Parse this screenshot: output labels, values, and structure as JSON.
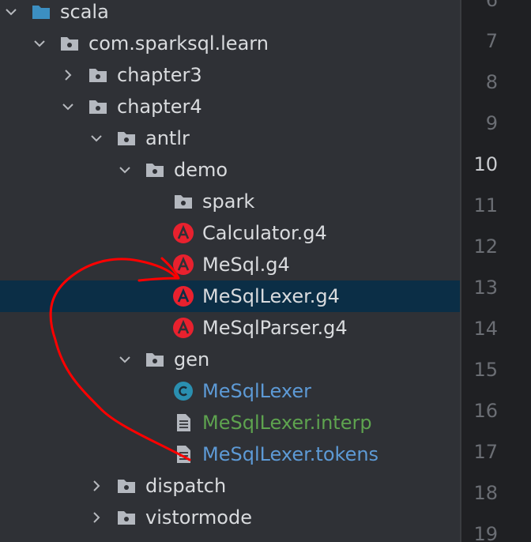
{
  "tree": {
    "items": [
      {
        "label": "scala",
        "kind": "folder",
        "color": "blue-folder",
        "expanded": true
      },
      {
        "label": "com.sparksql.learn",
        "kind": "folder",
        "expanded": true
      },
      {
        "label": "chapter3",
        "kind": "folder",
        "expanded": false
      },
      {
        "label": "chapter4",
        "kind": "folder",
        "expanded": true
      },
      {
        "label": "antlr",
        "kind": "folder",
        "expanded": true
      },
      {
        "label": "demo",
        "kind": "folder",
        "expanded": true
      },
      {
        "label": "spark",
        "kind": "folder"
      },
      {
        "label": "Calculator.g4",
        "kind": "antlr-file"
      },
      {
        "label": "MeSql.g4",
        "kind": "antlr-file"
      },
      {
        "label": "MeSqlLexer.g4",
        "kind": "antlr-file",
        "selected": true
      },
      {
        "label": "MeSqlParser.g4",
        "kind": "antlr-file"
      },
      {
        "label": "gen",
        "kind": "folder",
        "expanded": true
      },
      {
        "label": "MeSqlLexer",
        "kind": "class-file"
      },
      {
        "label": "MeSqlLexer.interp",
        "kind": "text-file"
      },
      {
        "label": "MeSqlLexer.tokens",
        "kind": "text-file"
      },
      {
        "label": "dispatch",
        "kind": "folder",
        "expanded": false
      },
      {
        "label": "vistormode",
        "kind": "folder",
        "expanded": false
      }
    ]
  },
  "gutter": {
    "lines": [
      "6",
      "7",
      "8",
      "9",
      "10",
      "11",
      "12",
      "13",
      "14",
      "15",
      "16",
      "17",
      "18",
      "19"
    ],
    "current": "10"
  },
  "colors": {
    "tree_bg": "#2f3136",
    "selected_bg": "#0b2e46",
    "text": "#d9dbde",
    "blue_text": "#5d9ad6",
    "green_text": "#5ea34f",
    "antlr_red": "#e8212e",
    "class_teal": "#2a8fb0",
    "folder_grey": "#b4b8bf",
    "folder_blue": "#3c8fc2",
    "annotation_red": "#ff0000"
  }
}
